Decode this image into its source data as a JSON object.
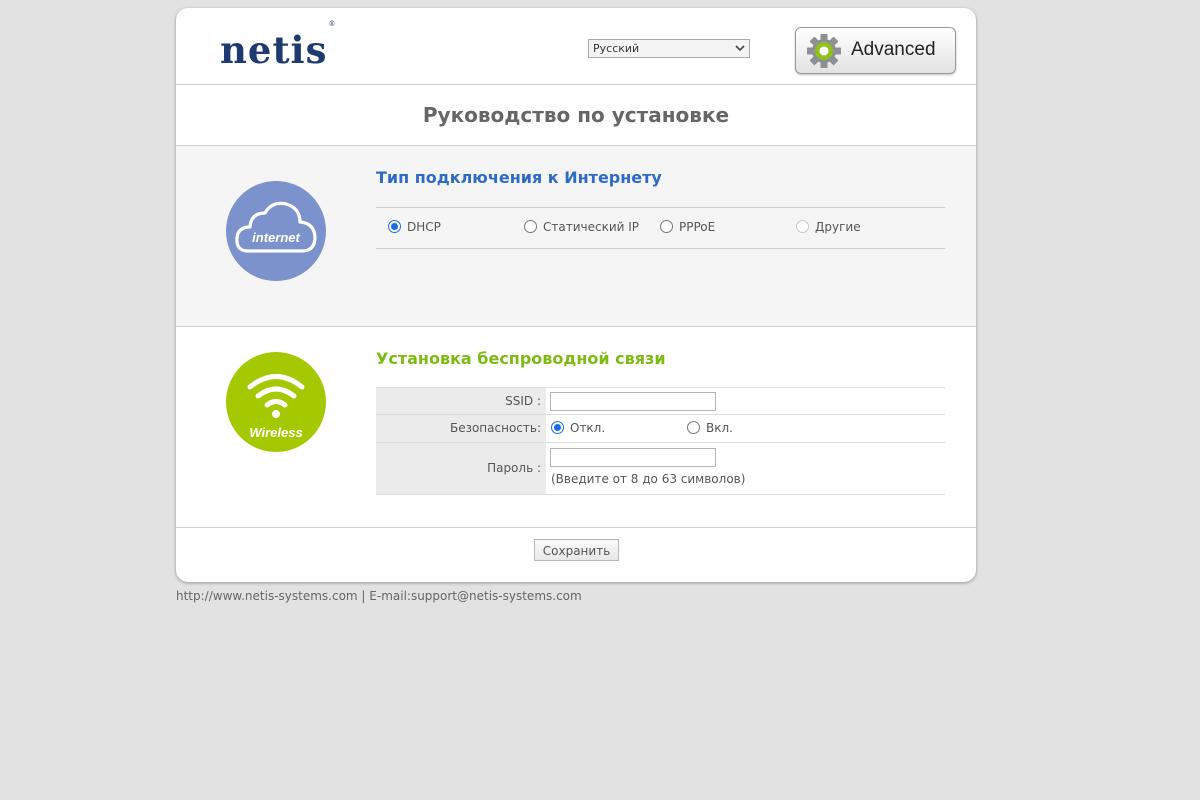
{
  "header": {
    "logo_text": "netis",
    "logo_mark": "®",
    "language": "Русский",
    "advanced_label": "Advanced",
    "advanced_icon": "gear-icon"
  },
  "page_title": "Руководство по установке",
  "internet": {
    "icon_text": "internet",
    "icon_color": "#7b92cc",
    "title": "Тип подключения к Интернету",
    "title_color": "#2e6bc7",
    "options": [
      {
        "label": "DHCP",
        "checked": true
      },
      {
        "label": "Статический IP",
        "checked": false
      },
      {
        "label": "PPPoE",
        "checked": false
      },
      {
        "label": "Другие",
        "checked": false,
        "disabled": true
      }
    ]
  },
  "wireless": {
    "icon_text": "Wireless",
    "icon_color": "#a4c900",
    "title": "Установка беспроводной связи",
    "title_color": "#7dbb12",
    "ssid_label": "SSID :",
    "ssid_value": "",
    "security_label": "Безопасность:",
    "security_options": [
      {
        "label": "Откл.",
        "checked": true
      },
      {
        "label": "Вкл.",
        "checked": false
      }
    ],
    "password_label": "Пароль :",
    "password_value": "",
    "password_hint": "(Введите от 8 до 63 символов)"
  },
  "save_label": "Сохранить",
  "footer_text": "http://www.netis-systems.com | E-mail:support@netis-systems.com"
}
